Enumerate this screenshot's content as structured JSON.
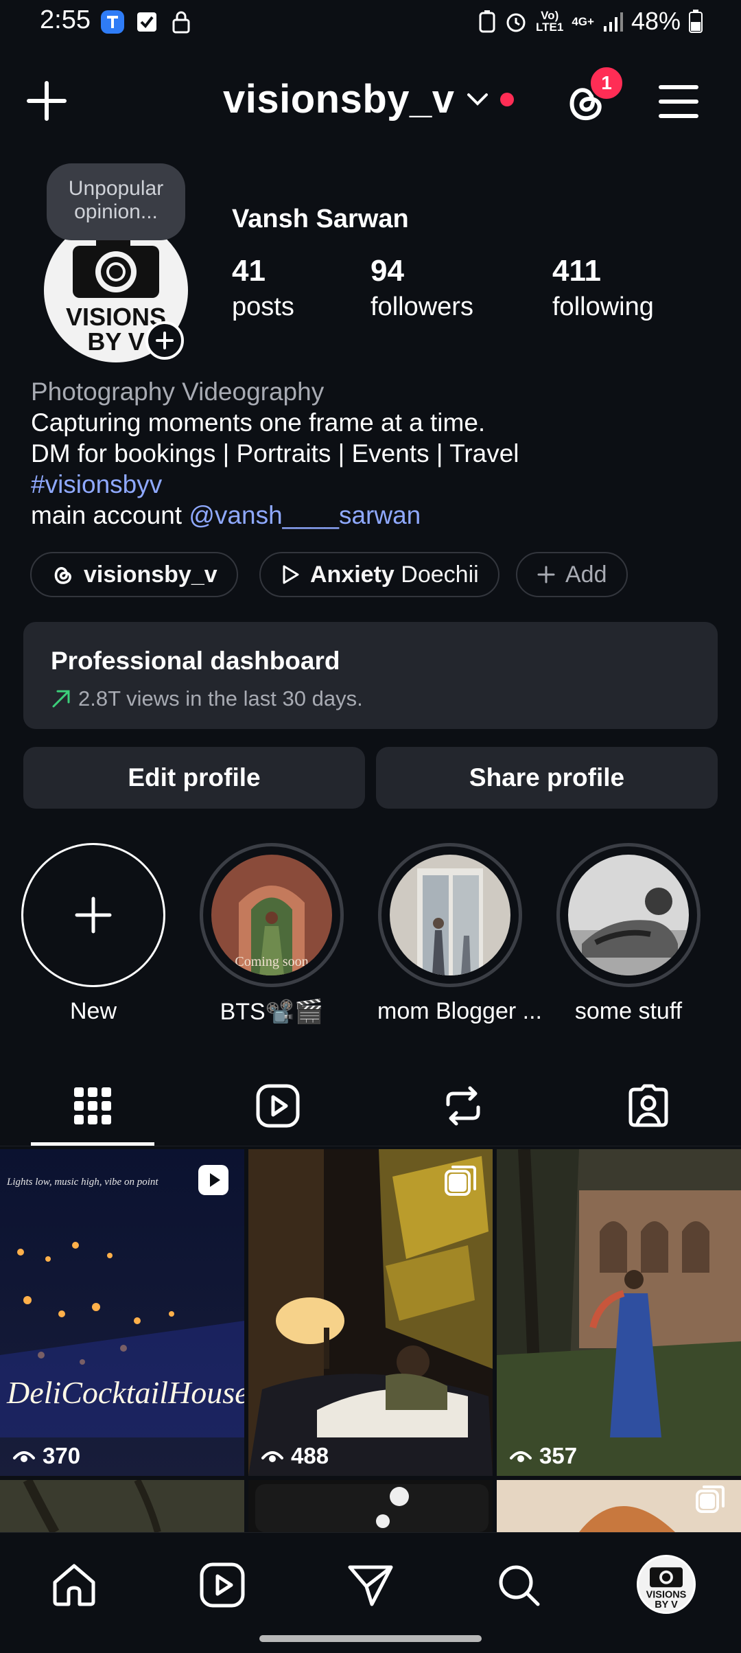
{
  "status_bar": {
    "time": "2:55",
    "battery": "48%",
    "network": "4G+"
  },
  "header": {
    "username": "visionsby_v",
    "threads_badge_count": "1"
  },
  "profile": {
    "note": "Unpopular opinion...",
    "avatar_text_line1": "VISIONS",
    "avatar_text_line2": "BY V",
    "display_name": "Vansh Sarwan",
    "stats": [
      {
        "value": "41",
        "label": "posts"
      },
      {
        "value": "94",
        "label": "followers"
      },
      {
        "value": "411",
        "label": "following"
      }
    ]
  },
  "bio": {
    "category": "Photography Videography",
    "line1": "Capturing moments one frame at a time.",
    "line2": "DM for bookings | Portraits | Events | Travel",
    "hashtag": "#visionsbyv",
    "line4_prefix": "main account",
    "mention": "@vansh____sarwan"
  },
  "chips": {
    "threads_label": "visionsby_v",
    "music_title": "Anxiety",
    "music_artist": "Doechii",
    "add_label": "Add"
  },
  "pro_dashboard": {
    "title": "Professional dashboard",
    "subtitle": "2.8T views in the last 30 days."
  },
  "actions": {
    "edit_label": "Edit profile",
    "share_label": "Share profile"
  },
  "highlights": [
    {
      "label": "New"
    },
    {
      "label": "BTS📽️🎬"
    },
    {
      "label": "mom Blogger ..."
    },
    {
      "label": "some stuff"
    }
  ],
  "highlight_overlay_text": "Coming soon",
  "posts": [
    {
      "views": "370",
      "overlay_top": "Lights low, music high, vibe on point",
      "overlay_sign": "DeliCocktailHouse",
      "badge": "reel"
    },
    {
      "views": "488",
      "badge": "carousel"
    },
    {
      "views": "357",
      "badge": "none"
    }
  ],
  "colors": {
    "background": "#0c0f14",
    "card": "#23262d",
    "link": "#8fa9ff",
    "badge_red": "#ff2d55",
    "muted": "#a8abb3"
  }
}
